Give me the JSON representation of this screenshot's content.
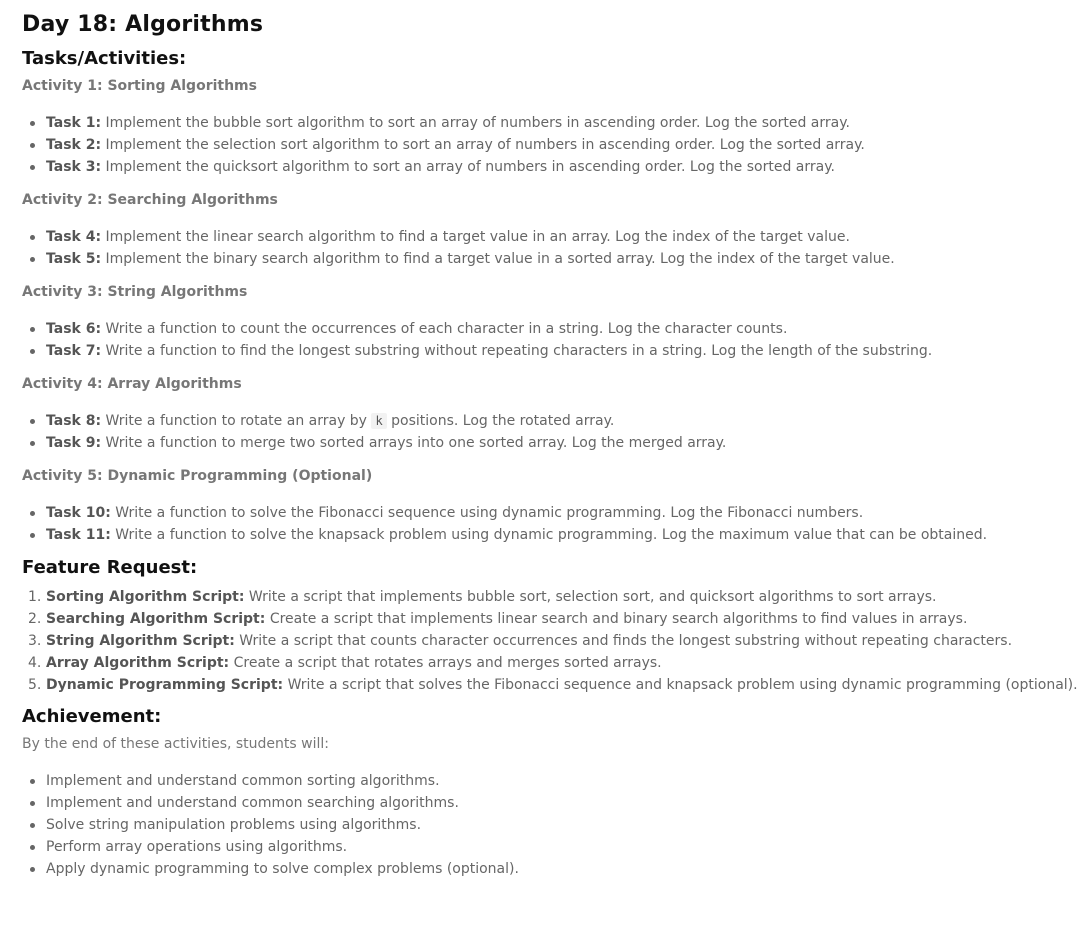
{
  "title": "Day 18: Algorithms",
  "tasks_heading": "Tasks/Activities:",
  "activities": [
    {
      "heading": "Activity 1: Sorting Algorithms",
      "tasks": [
        {
          "label": "Task 1:",
          "text": "Implement the bubble sort algorithm to sort an array of numbers in ascending order. Log the sorted array."
        },
        {
          "label": "Task 2:",
          "text": "Implement the selection sort algorithm to sort an array of numbers in ascending order. Log the sorted array."
        },
        {
          "label": "Task 3:",
          "text": "Implement the quicksort algorithm to sort an array of numbers in ascending order. Log the sorted array."
        }
      ]
    },
    {
      "heading": "Activity 2: Searching Algorithms",
      "tasks": [
        {
          "label": "Task 4:",
          "text": "Implement the linear search algorithm to find a target value in an array. Log the index of the target value."
        },
        {
          "label": "Task 5:",
          "text": "Implement the binary search algorithm to find a target value in a sorted array. Log the index of the target value."
        }
      ]
    },
    {
      "heading": "Activity 3: String Algorithms",
      "tasks": [
        {
          "label": "Task 6:",
          "text": "Write a function to count the occurrences of each character in a string. Log the character counts."
        },
        {
          "label": "Task 7:",
          "text": "Write a function to find the longest substring without repeating characters in a string. Log the length of the substring."
        }
      ]
    },
    {
      "heading": "Activity 4: Array Algorithms",
      "tasks": [
        {
          "label": "Task 8:",
          "text_before": "Write a function to rotate an array by",
          "code": "k",
          "text_after": "positions. Log the rotated array."
        },
        {
          "label": "Task 9:",
          "text": "Write a function to merge two sorted arrays into one sorted array. Log the merged array."
        }
      ]
    },
    {
      "heading": "Activity 5: Dynamic Programming (Optional)",
      "tasks": [
        {
          "label": "Task 10:",
          "text": "Write a function to solve the Fibonacci sequence using dynamic programming. Log the Fibonacci numbers."
        },
        {
          "label": "Task 11:",
          "text": "Write a function to solve the knapsack problem using dynamic programming. Log the maximum value that can be obtained."
        }
      ]
    }
  ],
  "feature_heading": "Feature Request:",
  "features": [
    {
      "num": "1.",
      "label": "Sorting Algorithm Script:",
      "text": "Write a script that implements bubble sort, selection sort, and quicksort algorithms to sort arrays."
    },
    {
      "num": "2.",
      "label": "Searching Algorithm Script:",
      "text": "Create a script that implements linear search and binary search algorithms to find values in arrays."
    },
    {
      "num": "3.",
      "label": "String Algorithm Script:",
      "text": "Write a script that counts character occurrences and finds the longest substring without repeating characters."
    },
    {
      "num": "4.",
      "label": "Array Algorithm Script:",
      "text": "Create a script that rotates arrays and merges sorted arrays."
    },
    {
      "num": "5.",
      "label": "Dynamic Programming Script:",
      "text": "Write a script that solves the Fibonacci sequence and knapsack problem using dynamic programming (optional)."
    }
  ],
  "achievement_heading": "Achievement:",
  "achievement_intro": "By the end of these activities, students will:",
  "achievements": [
    "Implement and understand common sorting algorithms.",
    "Implement and understand common searching algorithms.",
    "Solve string manipulation problems using algorithms.",
    "Perform array operations using algorithms.",
    "Apply dynamic programming to solve complex problems (optional)."
  ]
}
